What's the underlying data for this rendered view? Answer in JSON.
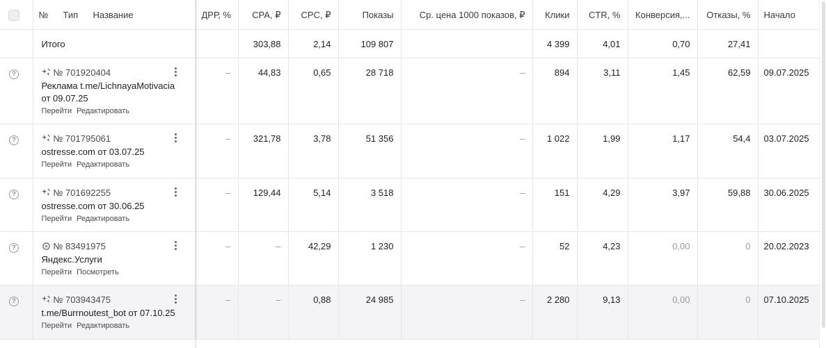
{
  "header": {
    "num": "№",
    "type": "Тип",
    "name": "Название",
    "drr": "ДРР, %",
    "cpa": "CPA, ₽",
    "cpc": "CPC, ₽",
    "shows": "Показы",
    "cpm": "Ср. цена 1000 показов, ₽",
    "clicks": "Клики",
    "ctr": "CTR, %",
    "conv": "Конверсия,...",
    "bounce": "Отказы, %",
    "start": "Начало"
  },
  "total": {
    "label": "Итого",
    "drr": "",
    "cpa": "303,88",
    "cpc": "2,14",
    "shows": "109 807",
    "cpm": "",
    "clicks": "4 399",
    "ctr": "4,01",
    "conv": "0,70",
    "bounce": "27,41",
    "start": ""
  },
  "rows": [
    {
      "type_icon": "sparkle-icon",
      "number": "№ 701920404",
      "name": "Реклама t.me/LichnayaMotivacia от 09.07.25",
      "action1": "Перейти",
      "action2": "Редактировать",
      "drr": "–",
      "cpa": "44,83",
      "cpc": "0,65",
      "shows": "28 718",
      "cpm": "–",
      "clicks": "894",
      "ctr": "3,11",
      "conv": "1,45",
      "bounce": "62,59",
      "start": "09.07.2025"
    },
    {
      "type_icon": "sparkle-icon",
      "number": "№ 701795061",
      "name": "ostresse.com от 03.07.25",
      "action1": "Перейти",
      "action2": "Редактировать",
      "drr": "–",
      "cpa": "321,78",
      "cpc": "3,78",
      "shows": "51 356",
      "cpm": "–",
      "clicks": "1 022",
      "ctr": "1,99",
      "conv": "1,17",
      "bounce": "54,4",
      "start": "03.07.2025"
    },
    {
      "type_icon": "sparkle-icon",
      "number": "№ 701692255",
      "name": "ostresse.com от 30.06.25",
      "action1": "Перейти",
      "action2": "Редактировать",
      "drr": "–",
      "cpa": "129,44",
      "cpc": "5,14",
      "shows": "3 518",
      "cpm": "–",
      "clicks": "151",
      "ctr": "4,29",
      "conv": "3,97",
      "bounce": "59,88",
      "start": "30.06.2025"
    },
    {
      "type_icon": "services-icon",
      "number": "№ 83491975",
      "name": "Яндекс.Услуги",
      "action1": "Перейти",
      "action2": "Посмотреть",
      "drr": "–",
      "cpa": "–",
      "cpc": "42,29",
      "shows": "1 230",
      "cpm": "–",
      "clicks": "52",
      "ctr": "4,23",
      "conv": "0,00",
      "bounce": "0",
      "start": "20.02.2023"
    },
    {
      "type_icon": "sparkle-icon",
      "number": "№ 703943475",
      "name": "t.me/Burrnoutest_bot от 07.10.25",
      "action1": "Перейти",
      "action2": "Редактировать",
      "drr": "–",
      "cpa": "–",
      "cpc": "0,88",
      "shows": "24 985",
      "cpm": "–",
      "clicks": "2 280",
      "ctr": "9,13",
      "conv": "0,00",
      "bounce": "0",
      "start": "07.10.2025"
    }
  ]
}
